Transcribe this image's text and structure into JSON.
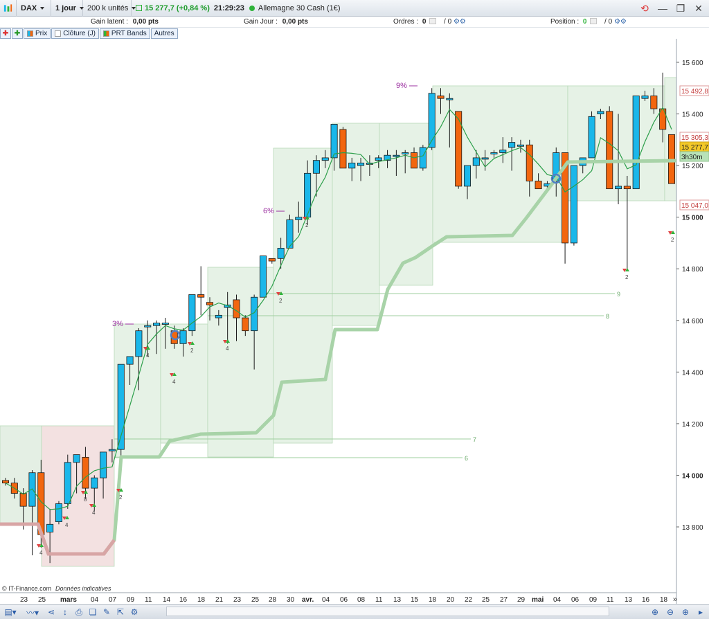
{
  "toolbar": {
    "instrument": "DAX",
    "period": "1 jour",
    "units": "200 k unités",
    "quote": "15 277,7 (+0,84 %)",
    "time": "21:29:23",
    "market": "Allemagne 30 Cash (1€)"
  },
  "info": {
    "gain_latent_label": "Gain latent :",
    "gain_latent_value": "0,00 pts",
    "gain_jour_label": "Gain Jour :",
    "gain_jour_value": "0,00 pts",
    "ordres_label": "Ordres :",
    "ordres_value": "0",
    "ordres_total": "/ 0",
    "position_label": "Position :",
    "position_value": "0",
    "position_total": "/ 0"
  },
  "legend": [
    "Prix",
    "Clôture (J)",
    "PRT Bands",
    "Autres"
  ],
  "colors": {
    "up": "#1ab7ea",
    "down": "#f2660f",
    "band": "#a8d3a8",
    "band_fill": "#e6f2e6",
    "quote": "#1f9d2c",
    "pct": "#9b2fa0"
  },
  "chart_data": {
    "type": "candlestick",
    "y_ticks": [
      "15 600",
      "15 400",
      "15 200",
      "15 000",
      "14 800",
      "14 600",
      "14 400",
      "14 200",
      "14 000",
      "13 800"
    ],
    "ylim": [
      13600,
      15660
    ],
    "x_ticks": [
      "23",
      "25",
      "mars",
      "04",
      "07",
      "09",
      "11",
      "14",
      "16",
      "18",
      "21",
      "23",
      "25",
      "28",
      "30",
      "avr.",
      "04",
      "06",
      "08",
      "11",
      "13",
      "15",
      "18",
      "20",
      "22",
      "25",
      "27",
      "29",
      "mai",
      "04",
      "06",
      "09",
      "11",
      "13",
      "16",
      "18"
    ],
    "price_labels": [
      "15 492,8",
      "15 305,3",
      "15 277,7",
      "3h30m",
      "15 047,0"
    ],
    "annotations": [
      "3%",
      "6%",
      "9%"
    ],
    "level_labels": [
      "9",
      "8",
      "7",
      "6"
    ],
    "signal_labels": [
      "4",
      "4",
      "8",
      "4",
      "2",
      "4",
      "4",
      "2",
      "4",
      "2",
      "2",
      "2",
      "2"
    ],
    "candles": [
      [
        13980,
        13990,
        13960,
        13970
      ],
      [
        13970,
        13990,
        13910,
        13930
      ],
      [
        13930,
        13950,
        13790,
        13880
      ],
      [
        13880,
        14020,
        13690,
        14010
      ],
      [
        14010,
        14060,
        13720,
        13770
      ],
      [
        13780,
        13870,
        13660,
        13810
      ],
      [
        13820,
        13900,
        13810,
        13890
      ],
      [
        13890,
        14080,
        13870,
        14050
      ],
      [
        14050,
        14080,
        13930,
        14080
      ],
      [
        14070,
        14110,
        13910,
        13950
      ],
      [
        13950,
        14000,
        13860,
        13990
      ],
      [
        13990,
        14070,
        13910,
        14090
      ],
      [
        14100,
        14140,
        14050,
        14100
      ],
      [
        14100,
        14420,
        14070,
        14430
      ],
      [
        14430,
        14460,
        14350,
        14460
      ],
      [
        14460,
        14570,
        14330,
        14560
      ],
      [
        14580,
        14600,
        14460,
        14580
      ],
      [
        14580,
        14600,
        14470,
        14590
      ],
      [
        14590,
        14610,
        14490,
        14590
      ],
      [
        14560,
        14580,
        14490,
        14510
      ],
      [
        14510,
        14570,
        14460,
        14560
      ],
      [
        14560,
        14700,
        14540,
        14700
      ],
      [
        14700,
        14810,
        14620,
        14690
      ],
      [
        14670,
        14690,
        14600,
        14660
      ],
      [
        14610,
        14640,
        14580,
        14620
      ],
      [
        14650,
        14710,
        14510,
        14660
      ],
      [
        14680,
        14700,
        14520,
        14610
      ],
      [
        14610,
        14620,
        14540,
        14560
      ],
      [
        14560,
        14700,
        14410,
        14690
      ],
      [
        14690,
        14850,
        14690,
        14850
      ],
      [
        14840,
        14840,
        14820,
        14830
      ],
      [
        14840,
        14920,
        14800,
        14880
      ],
      [
        14880,
        15010,
        14880,
        14990
      ],
      [
        14990,
        15060,
        14940,
        15000
      ],
      [
        15000,
        15220,
        14970,
        15170
      ],
      [
        15170,
        15240,
        15080,
        15220
      ],
      [
        15220,
        15260,
        15190,
        15230
      ],
      [
        15230,
        15360,
        15180,
        15360
      ],
      [
        15340,
        15350,
        15190,
        15190
      ],
      [
        15190,
        15230,
        15140,
        15210
      ],
      [
        15200,
        15230,
        15140,
        15210
      ],
      [
        15210,
        15240,
        15160,
        15210
      ],
      [
        15220,
        15240,
        15190,
        15230
      ],
      [
        15220,
        15260,
        15190,
        15240
      ],
      [
        15240,
        15260,
        15160,
        15240
      ],
      [
        15250,
        15260,
        15170,
        15250
      ],
      [
        15250,
        15270,
        15190,
        15190
      ],
      [
        15190,
        15280,
        15180,
        15270
      ],
      [
        15270,
        15500,
        15260,
        15480
      ],
      [
        15470,
        15500,
        15400,
        15460
      ],
      [
        15460,
        15480,
        15270,
        15460
      ],
      [
        15410,
        15410,
        15110,
        15120
      ],
      [
        15120,
        15200,
        15070,
        15200
      ],
      [
        15200,
        15260,
        15150,
        15230
      ],
      [
        15230,
        15260,
        15180,
        15230
      ],
      [
        15250,
        15260,
        15230,
        15250
      ],
      [
        15250,
        15310,
        15210,
        15260
      ],
      [
        15270,
        15310,
        15180,
        15290
      ],
      [
        15280,
        15300,
        15250,
        15280
      ],
      [
        15280,
        15300,
        15080,
        15140
      ],
      [
        15140,
        15170,
        15110,
        15110
      ],
      [
        15120,
        15140,
        15100,
        15130
      ],
      [
        15140,
        15270,
        15080,
        15250
      ],
      [
        15250,
        15250,
        14820,
        14900
      ],
      [
        14900,
        15180,
        14890,
        15200
      ],
      [
        15200,
        15200,
        15170,
        15230
      ],
      [
        15230,
        15410,
        15230,
        15390
      ],
      [
        15400,
        15420,
        15380,
        15410
      ],
      [
        15410,
        15430,
        15220,
        15110
      ],
      [
        15110,
        15400,
        15050,
        15120
      ],
      [
        15120,
        15160,
        14800,
        15110
      ],
      [
        15110,
        15380,
        15110,
        15470
      ],
      [
        15460,
        15490,
        15450,
        15470
      ],
      [
        15470,
        15500,
        15400,
        15420
      ],
      [
        15420,
        15560,
        15290,
        15340
      ],
      [
        15320,
        15320,
        15150,
        15130
      ]
    ]
  }
}
